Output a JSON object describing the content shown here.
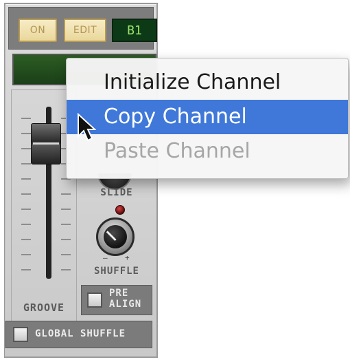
{
  "device": {
    "on_label": "ON",
    "edit_label": "EDIT",
    "pattern": "B1",
    "slide_label": "SLIDE",
    "shuffle_label": "SHUFFLE",
    "groove_label": "GROOVE",
    "pre_align_label_line1": "PRE",
    "pre_align_label_line2": "ALIGN",
    "global_shuffle_label": "GLOBAL SHUFFLE",
    "knob_min": "–",
    "knob_max": "+"
  },
  "context_menu": {
    "items": [
      {
        "label": "Initialize Channel",
        "state": "normal"
      },
      {
        "label": "Copy Channel",
        "state": "selected"
      },
      {
        "label": "Paste Channel",
        "state": "disabled"
      }
    ]
  },
  "colors": {
    "menu_highlight": "#3f78d8",
    "display_green": "#9be36b",
    "button_face": "#efe0aa"
  },
  "icons": {
    "cursor": "arrow-cursor-icon"
  }
}
